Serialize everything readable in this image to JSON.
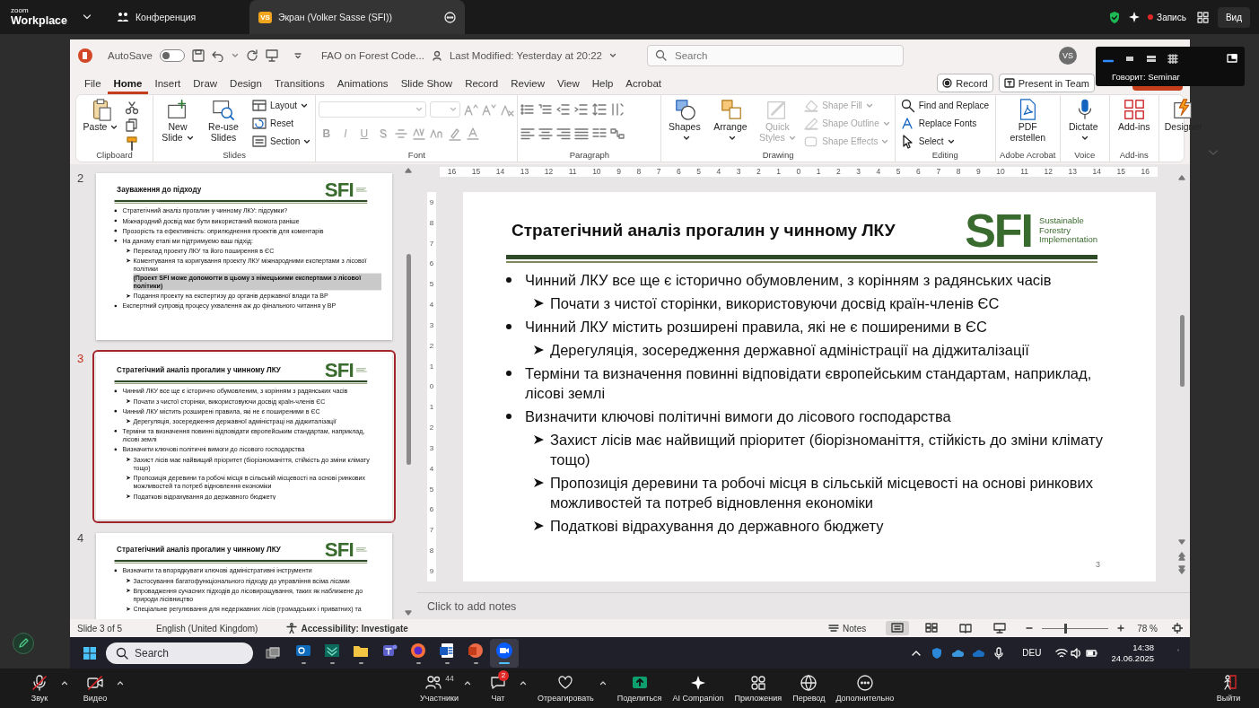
{
  "zoom_topbar": {
    "brand_top": "zoom",
    "brand": "Workplace",
    "tabs": [
      {
        "label": "Конференция",
        "selected": false
      },
      {
        "label": "Экран (Volker Sasse (SFI))",
        "badge": "VS",
        "selected": true
      }
    ],
    "record": "Запись",
    "view": "Вид"
  },
  "speaker_popup": {
    "layouts": [
      {
        "selected": true
      },
      {
        "selected": false
      },
      {
        "selected": false
      },
      {
        "selected": false
      }
    ],
    "text": "Говорит: Seminar"
  },
  "powerpoint": {
    "title_bar": {
      "autosave_label": "AutoSave",
      "autosave_on": false,
      "file_name": "FAO on Forest Code...",
      "last_modified": "Last Modified: Yesterday at 20:22",
      "search_placeholder": "Search",
      "avatar": "VS"
    },
    "menu": {
      "tabs": [
        {
          "label": "File",
          "selected": false
        },
        {
          "label": "Home",
          "selected": true
        },
        {
          "label": "Insert",
          "selected": false
        },
        {
          "label": "Draw",
          "selected": false
        },
        {
          "label": "Design",
          "selected": false
        },
        {
          "label": "Transitions",
          "selected": false
        },
        {
          "label": "Animations",
          "selected": false
        },
        {
          "label": "Slide Show",
          "selected": false
        },
        {
          "label": "Record",
          "selected": false
        },
        {
          "label": "Review",
          "selected": false
        },
        {
          "label": "View",
          "selected": false
        },
        {
          "label": "Help",
          "selected": false
        },
        {
          "label": "Acrobat",
          "selected": false
        }
      ],
      "record_button": "Record",
      "present_button": "Present in Team"
    },
    "ribbon": {
      "groups": [
        {
          "kind": "clipboard",
          "label": "Clipboard",
          "buttons": [
            {
              "label": "Paste",
              "menu": true,
              "disabled": false
            }
          ]
        },
        {
          "kind": "slides",
          "label": "Slides",
          "buttons": [
            {
              "label": "New Slide",
              "menu": true,
              "disabled": false
            },
            {
              "label": "Re-use Slides",
              "menu": false,
              "disabled": false
            },
            {
              "label": "Layout",
              "menu": true,
              "disabled": false
            },
            {
              "label": "Reset",
              "menu": false,
              "disabled": false
            },
            {
              "label": "Section",
              "menu": true,
              "disabled": false
            }
          ]
        },
        {
          "kind": "font",
          "label": "Font",
          "buttons": [
            {
              "label": "B",
              "menu": false,
              "disabled": true
            },
            {
              "label": "I",
              "menu": false,
              "disabled": true
            },
            {
              "label": "U",
              "menu": false,
              "disabled": true
            },
            {
              "label": "S",
              "menu": false,
              "disabled": true
            }
          ]
        },
        {
          "kind": "paragraph",
          "label": "Paragraph"
        },
        {
          "kind": "drawing",
          "label": "Drawing",
          "buttons": [
            {
              "label": "Shapes",
              "menu": true,
              "disabled": false
            },
            {
              "label": "Arrange",
              "menu": true,
              "disabled": false
            },
            {
              "label": "Quick Styles",
              "menu": true,
              "disabled": true
            },
            {
              "label": "Shape Fill",
              "menu": true,
              "disabled": true
            },
            {
              "label": "Shape Outline",
              "menu": true,
              "disabled": true
            },
            {
              "label": "Shape Effects",
              "menu": true,
              "disabled": true
            }
          ]
        },
        {
          "kind": "editing",
          "label": "Editing",
          "buttons": [
            {
              "label": "Find and Replace",
              "menu": false,
              "disabled": false
            },
            {
              "label": "Replace Fonts",
              "menu": false,
              "disabled": false
            },
            {
              "label": "Select",
              "menu": true,
              "disabled": false
            }
          ]
        },
        {
          "kind": "acrobat",
          "label": "Adobe Acrobat",
          "buttons": [
            {
              "label": "PDF erstellen",
              "menu": false,
              "disabled": false
            }
          ]
        },
        {
          "kind": "voice",
          "label": "Voice",
          "buttons": [
            {
              "label": "Dictate",
              "menu": true,
              "disabled": false
            }
          ]
        },
        {
          "kind": "addins",
          "label": "Add-ins",
          "buttons": [
            {
              "label": "Add-ins",
              "menu": false,
              "disabled": false
            }
          ]
        },
        {
          "kind": "designer",
          "buttons": [
            {
              "label": "Designer",
              "menu": false,
              "disabled": false
            }
          ]
        }
      ]
    },
    "thumbnails": [
      {
        "number": "2",
        "selected": false,
        "title": "Зауваження до підходу",
        "logo_mark": "SFI",
        "bullets": [
          {
            "text": "Стратегічний аналіз прогалин у чинному ЛКУ: підсумки?"
          },
          {
            "text": "Міжнародний досвід має бути використаний якомога раніше"
          },
          {
            "text": "Прозорість та ефективність: оприлюднення проектів для коментарів"
          },
          {
            "text": "На даному етапі ми підтримуємо ваш підхід:",
            "children": [
              {
                "text": "Переклад проекту ЛКУ та його поширення в ЄС"
              },
              {
                "text": "Коментування та коригування проекту ЛКУ міжнародними експертами з лісової політики",
                "note": "(Проект SFI може допомогти в цьому з німецькими експертами з лісової політики)"
              },
              {
                "text": "Подання проекту на експертизу до органів державної влади та ВР"
              }
            ]
          },
          {
            "text": "Експертний супровід процесу ухвалення аж до фінального читання у ВР"
          }
        ]
      },
      {
        "number": "3",
        "selected": true,
        "title": "Стратегічний аналіз прогалин у чинному ЛКУ",
        "logo_mark": "SFI",
        "bullets": [
          {
            "text": "Чинний ЛКУ все ще є історично обумовленим, з корінням з радянських часів",
            "children": [
              {
                "text": "Почати з чистої сторінки, використовуючи досвід країн-членів ЄС"
              }
            ]
          },
          {
            "text": "Чинний ЛКУ містить розширені правила, які не є поширеними в ЄС",
            "children": [
              {
                "text": "Дерегуляція, зосередження державної адміністраці на діджиталізації"
              }
            ]
          },
          {
            "text": "Терміни та визначення повинні відповідати європейським стандартам, наприклад, лісові землі"
          },
          {
            "text": "Визначити ключові політичні вимоги до лісового господарства",
            "children": [
              {
                "text": "Захист лісів має найвищий пріоритет (біорізноманіття, стійкість до зміни клімату тощо)"
              },
              {
                "text": "Пропозиція деревини та робочі місця в сільській місцевості на основі ринкових можливостей та потреб відновлення економіки"
              },
              {
                "text": "Податкові відрахування до державного бюджету"
              }
            ]
          }
        ]
      },
      {
        "number": "4",
        "selected": false,
        "title": "Стратегічний аналіз прогалин у чинному ЛКУ",
        "logo_mark": "SFI",
        "bullets": [
          {
            "text": "Визначити та впорядкувати ключові адміністративні інструменти",
            "children": [
              {
                "text": "Застосування багатофункціонального підходу до управління всіма лісами"
              },
              {
                "text": "Впровадження сучасних підходів до лісовирощування, таких як наближене до природи лісівництво"
              },
              {
                "text": "Спеціальне регулювання для недержавних лісів (громадських і приватних) та"
              }
            ]
          }
        ]
      }
    ],
    "ruler": {
      "horizontal": [
        "16",
        "15",
        "14",
        "13",
        "12",
        "11",
        "10",
        "9",
        "8",
        "7",
        "6",
        "5",
        "4",
        "3",
        "2",
        "1",
        "0",
        "1",
        "2",
        "3",
        "4",
        "5",
        "6",
        "7",
        "8",
        "9",
        "10",
        "11",
        "12",
        "13",
        "14",
        "15",
        "16"
      ],
      "vertical": [
        "9",
        "8",
        "7",
        "6",
        "5",
        "4",
        "3",
        "2",
        "1",
        "0",
        "1",
        "2",
        "3",
        "4",
        "5",
        "6",
        "7",
        "8",
        "9"
      ]
    },
    "slide": {
      "title": "Стратегічний аналіз прогалин у чинному ЛКУ",
      "logo_mark": "SFI",
      "logo_caption": "Sustainable Forestry Implementation",
      "bullets": [
        {
          "text": "Чинний ЛКУ все ще є історично обумовленим, з корінням з радянських часів",
          "children": [
            {
              "text": "Почати з чистої сторінки, використовуючи досвід країн-членів ЄС"
            }
          ]
        },
        {
          "text": "Чинний ЛКУ містить розширені правила, які не є поширеними в ЄС",
          "children": [
            {
              "text": "Дерегуляція, зосередження державної адміністрації на діджиталізації"
            }
          ]
        },
        {
          "text": "Терміни та визначення повинні відповідати європейським стандартам, наприклад, лісові землі"
        },
        {
          "text": "Визначити ключові політичні вимоги до лісового господарства",
          "children": [
            {
              "text": "Захист лісів має найвищий пріоритет (біорізноманіття, стійкість до зміни клімату тощо)"
            },
            {
              "text": "Пропозиція деревини та робочі місця в сільській місцевості на основі ринкових можливостей та потреб відновлення економіки"
            },
            {
              "text": "Податкові відрахування до державного бюджету"
            }
          ]
        }
      ],
      "page_number": "3"
    },
    "notes_placeholder": "Click to add notes",
    "status_bar": {
      "slide_info": "Slide 3 of 5",
      "language": "English (United Kingdom)",
      "accessibility": "Accessibility: Investigate",
      "notes": "Notes",
      "views": [
        {
          "kind": "normal",
          "selected": true
        },
        {
          "kind": "sorter",
          "selected": false
        },
        {
          "kind": "reading",
          "selected": false
        },
        {
          "kind": "slideshow",
          "selected": false
        }
      ],
      "zoom": {
        "level": 0.35,
        "label": "78 %"
      }
    }
  },
  "taskbar": {
    "search_placeholder": "Search",
    "apps": [
      {
        "kind": "mail",
        "running": true,
        "selected": false
      },
      {
        "kind": "reader",
        "running": true,
        "selected": false
      },
      {
        "kind": "folder",
        "running": true,
        "selected": false
      },
      {
        "kind": "teams",
        "running": false,
        "selected": false
      },
      {
        "kind": "browser",
        "running": true,
        "selected": false
      },
      {
        "kind": "word",
        "running": true,
        "selected": false
      },
      {
        "kind": "slides",
        "running": true,
        "selected": false
      },
      {
        "kind": "zoom",
        "running": true,
        "selected": true
      }
    ],
    "language": "DEU",
    "time": "14:38",
    "date": "24.06.2025"
  },
  "zoom_toolbar": {
    "items": [
      {
        "kind": "audio",
        "label": "Звук",
        "muted": true,
        "menu": true
      },
      {
        "kind": "video",
        "label": "Видео",
        "muted": true,
        "menu": true
      },
      {
        "kind": "participants",
        "label": "Участники",
        "count": "44",
        "muted": false,
        "menu": true
      },
      {
        "kind": "chat",
        "label": "Чат",
        "badge": "2",
        "muted": false,
        "menu": true
      },
      {
        "kind": "react",
        "label": "Отреагировать",
        "muted": false,
        "menu": true
      },
      {
        "kind": "share",
        "label": "Поделиться",
        "muted": false,
        "menu": false
      },
      {
        "kind": "companion",
        "label": "AI Companion",
        "muted": false,
        "menu": false
      },
      {
        "kind": "apps",
        "label": "Приложения",
        "muted": false,
        "menu": false
      },
      {
        "kind": "translate",
        "label": "Перевод",
        "muted": false,
        "menu": false
      },
      {
        "kind": "more",
        "label": "Дополнительно",
        "muted": false,
        "menu": false
      },
      {
        "kind": "leave",
        "label": "Выйти",
        "muted": false,
        "menu": false
      }
    ]
  }
}
